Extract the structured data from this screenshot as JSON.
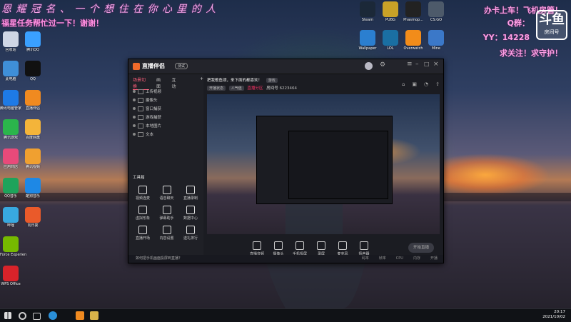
{
  "overlay": {
    "watermark": "恩 耀 冠 名 、 一 个 想 住 在 你 心 里 的 人",
    "left_sub": "福星任务帮忙过一下！谢谢！",
    "right_lines": [
      "办卡上车！飞机房管！",
      "Q群：",
      "YY：14228",
      "求关注！求守护！"
    ],
    "logo_text": "斗鱼",
    "logo_sub": "房间号"
  },
  "desktop_left": [
    {
      "label": "回收站",
      "color": "#cfd6e4"
    },
    {
      "label": "腾讯QQ",
      "color": "#3aa0ff"
    },
    {
      "label": "此电脑",
      "color": "#3f8fd8"
    },
    {
      "label": "QQ",
      "color": "#111"
    },
    {
      "label": "腾讯电脑管家",
      "color": "#1e7ae6"
    },
    {
      "label": "直播伴侣",
      "color": "#f08a20"
    },
    {
      "label": "腾讯游戏",
      "color": "#2bb54c"
    },
    {
      "label": "百度网盘",
      "color": "#f4b43a"
    },
    {
      "label": "应用商店",
      "color": "#e84a7a"
    },
    {
      "label": "腾讯视频",
      "color": "#f0a030"
    },
    {
      "label": "QQ音乐",
      "color": "#1ea35b"
    },
    {
      "label": "酷狗音乐",
      "color": "#1e88e5"
    },
    {
      "label": "哔哩",
      "color": "#38a8e0"
    },
    {
      "label": "向日葵",
      "color": "#ea5a2a"
    },
    {
      "label": "GeForce Experience",
      "color": "#76b900"
    },
    {
      "label": "WPS Office",
      "color": "#d8232a"
    }
  ],
  "desktop_top": [
    {
      "label": "Steam",
      "color": "#1b2838"
    },
    {
      "label": "PUBG",
      "color": "#c9a227"
    },
    {
      "label": "Phasmop...",
      "color": "#222"
    },
    {
      "label": "CS:GO",
      "color": "#4d5a6a"
    },
    {
      "label": "Wallpaper",
      "color": "#2b7fd0"
    },
    {
      "label": "LOL",
      "color": "#1a6fa3"
    },
    {
      "label": "Overwatch",
      "color": "#f28c1a"
    },
    {
      "label": "Mine",
      "color": "#3b78c8"
    }
  ],
  "app": {
    "title": "直播伴侣",
    "title_badge": "测试",
    "tabs": [
      "场景切换",
      "画面",
      "互动"
    ],
    "scenes": [
      "上传视频",
      "摄像头",
      "窗口捕获",
      "游戏捕获",
      "本地图片",
      "文本"
    ],
    "tools_title": "工具箱",
    "tools": [
      [
        "视频连麦",
        "语音聊天",
        "直播录制"
      ],
      [
        "虚拟形象",
        "弹幕助手",
        "数据中心"
      ],
      [
        "直播开场",
        "内容设置",
        "送礼排行"
      ]
    ],
    "stream_title": "把我歌鱼颂，来下面的都喜欢！",
    "pill_tag": "游戏",
    "stream_meta": [
      "开播状态",
      "人气值",
      "直播分区",
      "房间号",
      "6223464"
    ],
    "controls": [
      "直播音频",
      "摄像头",
      "手机投屏",
      "录屏",
      "麦克风",
      "扬声器"
    ],
    "live_button": "开始直播",
    "notice": "如何把手机画面投屏到直播？",
    "status": [
      "码率",
      "帧率",
      "CPU",
      "内存",
      "开播"
    ]
  },
  "taskbar": {
    "time": "20:17",
    "date": "2021/10/02"
  }
}
